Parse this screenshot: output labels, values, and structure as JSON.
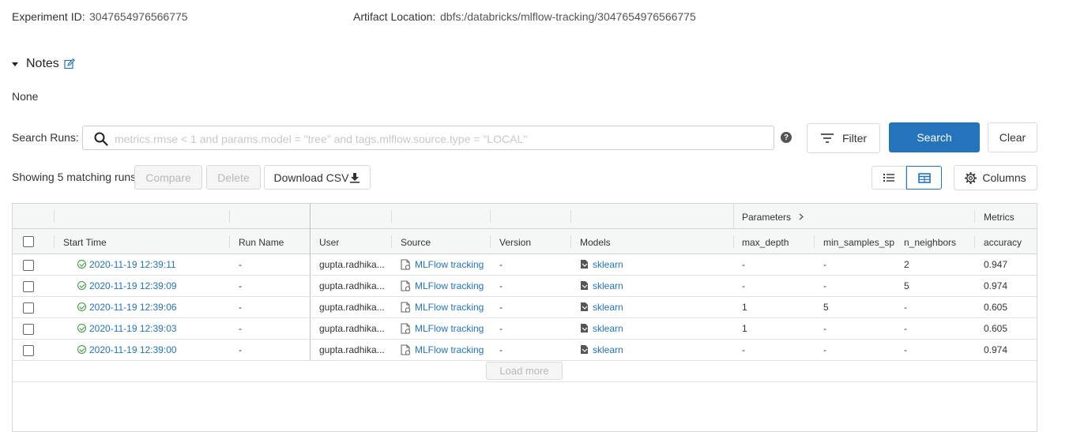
{
  "experiment": {
    "id_label": "Experiment ID:",
    "id_value": "3047654976566775",
    "artifact_label": "Artifact Location:",
    "artifact_value": "dbfs:/databricks/mlflow-tracking/3047654976566775"
  },
  "notes": {
    "title": "Notes",
    "content": "None"
  },
  "search": {
    "label": "Search Runs:",
    "placeholder": "metrics.rmse < 1 and params.model = \"tree\" and tags.mlflow.source.type = \"LOCAL\"",
    "value": "",
    "help_glyph": "?",
    "filter_label": "Filter",
    "search_label": "Search",
    "clear_label": "Clear"
  },
  "toolbar": {
    "matching_text": "Showing 5 matching runs",
    "compare_label": "Compare",
    "delete_label": "Delete",
    "download_label": "Download CSV",
    "columns_label": "Columns",
    "active_view": "table"
  },
  "table": {
    "group_headers": {
      "parameters": "Parameters",
      "metrics": "Metrics"
    },
    "columns": [
      "Start Time",
      "Run Name",
      "User",
      "Source",
      "Version",
      "Models",
      "max_depth",
      "min_samples_split",
      "n_neighbors",
      "accuracy"
    ],
    "rows": [
      {
        "start_time": "2020-11-19 12:39:11",
        "run_name": "-",
        "user": "gupta.radhika...",
        "source": "MLFlow tracking",
        "version": "-",
        "model": "sklearn",
        "max_depth": "-",
        "min_samples_split": "-",
        "n_neighbors": "2",
        "accuracy": "0.947"
      },
      {
        "start_time": "2020-11-19 12:39:09",
        "run_name": "-",
        "user": "gupta.radhika...",
        "source": "MLFlow tracking",
        "version": "-",
        "model": "sklearn",
        "max_depth": "-",
        "min_samples_split": "-",
        "n_neighbors": "5",
        "accuracy": "0.974"
      },
      {
        "start_time": "2020-11-19 12:39:06",
        "run_name": "-",
        "user": "gupta.radhika...",
        "source": "MLFlow tracking",
        "version": "-",
        "model": "sklearn",
        "max_depth": "1",
        "min_samples_split": "5",
        "n_neighbors": "-",
        "accuracy": "0.605"
      },
      {
        "start_time": "2020-11-19 12:39:03",
        "run_name": "-",
        "user": "gupta.radhika...",
        "source": "MLFlow tracking",
        "version": "-",
        "model": "sklearn",
        "max_depth": "1",
        "min_samples_split": "-",
        "n_neighbors": "-",
        "accuracy": "0.605"
      },
      {
        "start_time": "2020-11-19 12:39:00",
        "run_name": "-",
        "user": "gupta.radhika...",
        "source": "MLFlow tracking",
        "version": "-",
        "model": "sklearn",
        "max_depth": "-",
        "min_samples_split": "-",
        "n_neighbors": "-",
        "accuracy": "0.974"
      }
    ],
    "load_more_label": "Load more"
  },
  "colors": {
    "primary": "#2374bb",
    "success": "#3a9a3a",
    "link": "#2374bb",
    "border": "#d6d6d6"
  },
  "icons": {
    "notes_edit": "edit-icon",
    "search": "search-icon",
    "help": "help-icon",
    "filter": "filter-icon",
    "download": "download-icon",
    "list_view": "list-view-icon",
    "table_view": "table-view-icon",
    "columns": "gear-icon",
    "status": "check-circle-icon",
    "source": "notebook-icon",
    "model": "model-icon",
    "parameters_expand": "chevron-right-icon"
  }
}
